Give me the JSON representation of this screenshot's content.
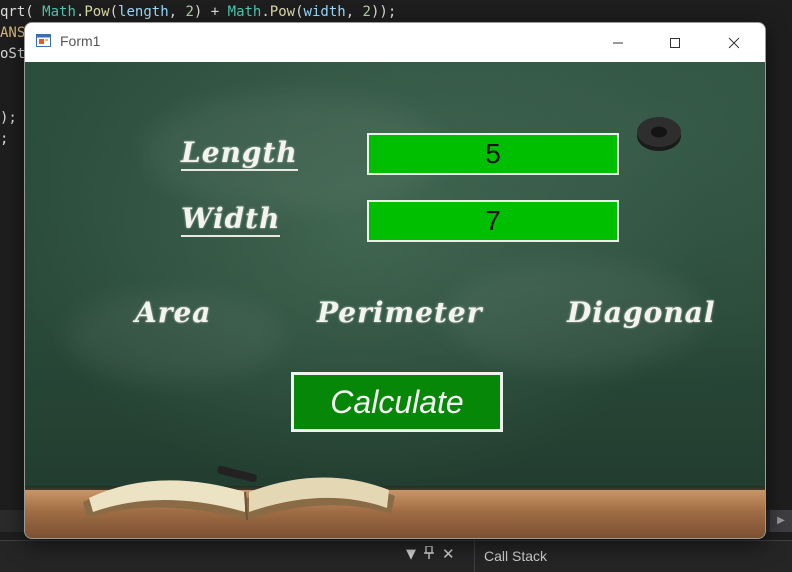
{
  "editor": {
    "lines": [
      {
        "segments": [
          [
            "",
            "qrt( "
          ],
          [
            "tk-type",
            "Math"
          ],
          [
            "",
            "."
          ],
          [
            "tk-fn",
            "Pow"
          ],
          [
            "",
            "("
          ],
          [
            "tk-param",
            "length"
          ],
          [
            "",
            ", "
          ],
          [
            "tk-num",
            "2"
          ],
          [
            "",
            ") + "
          ],
          [
            "tk-type",
            "Math"
          ],
          [
            "",
            "."
          ],
          [
            "tk-fn",
            "Pow"
          ],
          [
            "",
            "("
          ],
          [
            "tk-param",
            "width"
          ],
          [
            "",
            ", "
          ],
          [
            "tk-num",
            "2"
          ],
          [
            "",
            "));"
          ]
        ]
      },
      {
        "segments": [
          [
            "tk-const",
            "ANS"
          ]
        ]
      },
      {
        "segments": [
          [
            "",
            "oSt"
          ]
        ]
      },
      {
        "segments": [
          [
            "",
            ""
          ]
        ]
      },
      {
        "segments": [
          [
            "",
            ""
          ]
        ]
      },
      {
        "segments": [
          [
            "",
            ");"
          ]
        ]
      },
      {
        "segments": [
          [
            "",
            ";"
          ]
        ]
      }
    ]
  },
  "bottom_panel": {
    "dropdown_icon": "caret-down-icon",
    "pin_icon": "pin-icon",
    "close_icon": "close-icon",
    "tab": "Call Stack"
  },
  "window": {
    "title": "Form1",
    "app_icon": "winforms-app-icon",
    "controls": {
      "minimize": "minimize-icon",
      "maximize": "maximize-icon",
      "close": "close-icon"
    }
  },
  "form": {
    "length_label": "Length",
    "width_label": "Width",
    "length_value": "5",
    "width_value": "7",
    "area_label": "Area",
    "perimeter_label": "Perimeter",
    "diagonal_label": "Diagonal",
    "calculate_label": "Calculate"
  },
  "colors": {
    "board": "#2c4f3d",
    "field_bg": "#00bf00",
    "button_bg": "#078707",
    "chalk": "#f4f4ee"
  }
}
